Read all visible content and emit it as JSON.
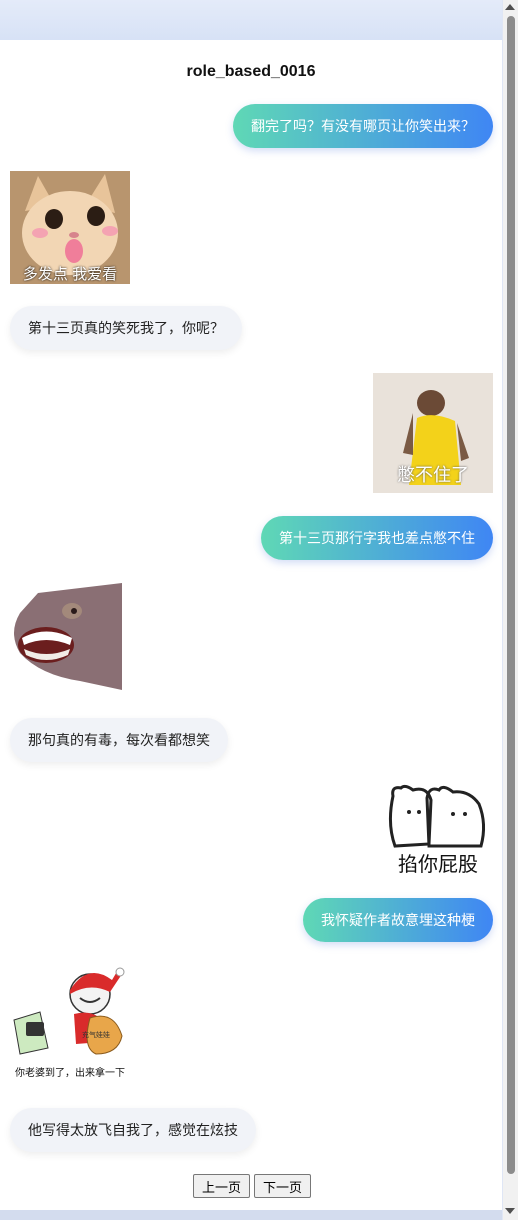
{
  "page": {
    "title": "role_based_0016"
  },
  "messages": [
    {
      "side": "right",
      "type": "text",
      "text": "翻完了吗？有没有哪页让你笑出来？"
    },
    {
      "side": "left",
      "type": "sticker",
      "icon": "cat-tongue-sticker",
      "caption": "多发点 我爱看"
    },
    {
      "side": "left",
      "type": "text",
      "text": "第十三页真的笑死我了，你呢？"
    },
    {
      "side": "right",
      "type": "sticker",
      "icon": "yellow-shirt-laughing-sticker",
      "caption": "憋不住了"
    },
    {
      "side": "right",
      "type": "text",
      "text": "第十三页那行字我也差点憋不住"
    },
    {
      "side": "left",
      "type": "sticker",
      "icon": "grinning-fish-sticker",
      "caption": ""
    },
    {
      "side": "left",
      "type": "text",
      "text": "那句真的有毒，每次看都想笑"
    },
    {
      "side": "right",
      "type": "sticker",
      "icon": "bears-sticker",
      "caption": "掐你屁股"
    },
    {
      "side": "right",
      "type": "text",
      "text": "我怀疑作者故意埋这种梗"
    },
    {
      "side": "left",
      "type": "sticker",
      "icon": "santa-meme-sticker",
      "caption": "你老婆到了，出来拿一下",
      "bag_text": "充气娃娃"
    },
    {
      "side": "left",
      "type": "text",
      "text": "他写得太放飞自我了，感觉在炫技"
    }
  ],
  "pagination": {
    "prev_label": "上一页",
    "next_label": "下一页"
  }
}
